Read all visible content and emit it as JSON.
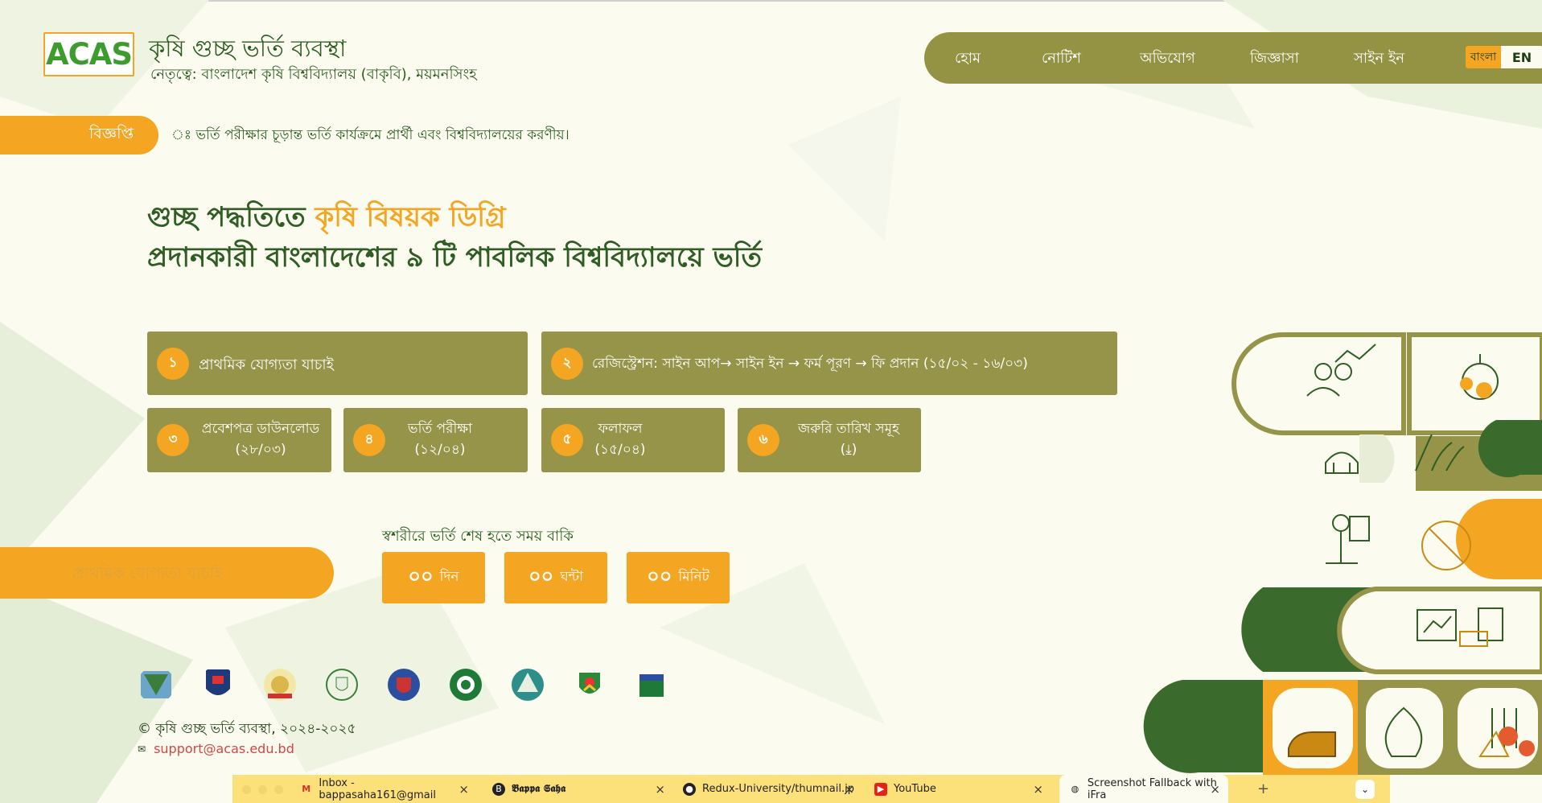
{
  "header": {
    "logo": "ACAS",
    "title": "কৃষি গুচ্ছ ভর্তি ব্যবস্থা",
    "subtitle": "নেতৃত্বে: বাংলাদেশ কৃষি বিশ্ববিদ্যালয় (বাকৃবি), ময়মনসিংহ"
  },
  "nav": {
    "items": [
      "হোম",
      "নোটিশ",
      "অভিযোগ",
      "জিজ্ঞাসা",
      "সাইন ইন"
    ],
    "lang_bn": "বাংলা",
    "lang_en": "EN"
  },
  "notice": {
    "tag": "বিজ্ঞপ্তি",
    "text": "ঃ ভর্তি পরীক্ষার চূড়ান্ত ভর্তি কার্যক্রমে প্রার্থী এবং বিশ্ববিদ্যালয়ের করণীয়।"
  },
  "hero": {
    "line1_part1": "গুচ্ছ পদ্ধতিতে ",
    "line1_accent": "কৃষি বিষয়ক ডিগ্রি",
    "line2": "প্রদানকারী বাংলাদেশের ৯ টি পাবলিক বিশ্ববিদ্যালয়ে ভর্তি"
  },
  "steps": [
    {
      "num": "১",
      "label": "প্রাথমিক যোগ্যতা যাচাই"
    },
    {
      "num": "২",
      "label": "রেজিস্ট্রেশন: সাইন আপ→ সাইন ইন → ফর্ম পূরণ → ফি প্রদান (১৫/০২ - ১৬/০৩)"
    },
    {
      "num": "৩",
      "label": "প্রবেশপত্র ডাউনলোড",
      "sub": "(২৮/০৩)"
    },
    {
      "num": "৪",
      "label": "ভর্তি পরীক্ষা",
      "sub": "(১২/০৪)"
    },
    {
      "num": "৫",
      "label": "ফলাফল",
      "sub": "(১৫/০৪)"
    },
    {
      "num": "৬",
      "label": "জরুরি তারিখ সমূহ",
      "sub": "(⤓)"
    }
  ],
  "eligibility": {
    "placeholder": "প্রাথমিক যোগ্যতা যাচাই"
  },
  "countdown": {
    "label": "স্বশরীরে ভর্তি শেষ হতে সময় বাকি",
    "days": "০০",
    "days_unit": "দিন",
    "hours": "০০",
    "hours_unit": "ঘন্টা",
    "minutes": "০০",
    "minutes_unit": "মিনিট"
  },
  "footer": {
    "copyright": "© কৃষি গুচ্ছ ভর্তি ব্যবস্থা, ২০২৪-২০২৫",
    "email": "support@acas.edu.bd"
  },
  "taskbar": {
    "tabs": [
      {
        "title": "Inbox - bappasaha161@gmail",
        "icon": "gmail-icon"
      },
      {
        "title": "𝕭𝖆𝖕𝖕𝖆 𝕾𝖆𝖍𝖆",
        "icon": "profile-icon"
      },
      {
        "title": "Redux-University/thumnail.jp",
        "icon": "github-icon"
      },
      {
        "title": "YouTube",
        "icon": "youtube-icon"
      },
      {
        "title": "Screenshot Fallback with iFra",
        "icon": "globe-icon"
      }
    ]
  },
  "colors": {
    "primary_green": "#2f5d23",
    "olive": "#959449",
    "accent_orange": "#f4a623",
    "background": "#fbfbf0",
    "taskbar_yellow": "#fce17b"
  }
}
